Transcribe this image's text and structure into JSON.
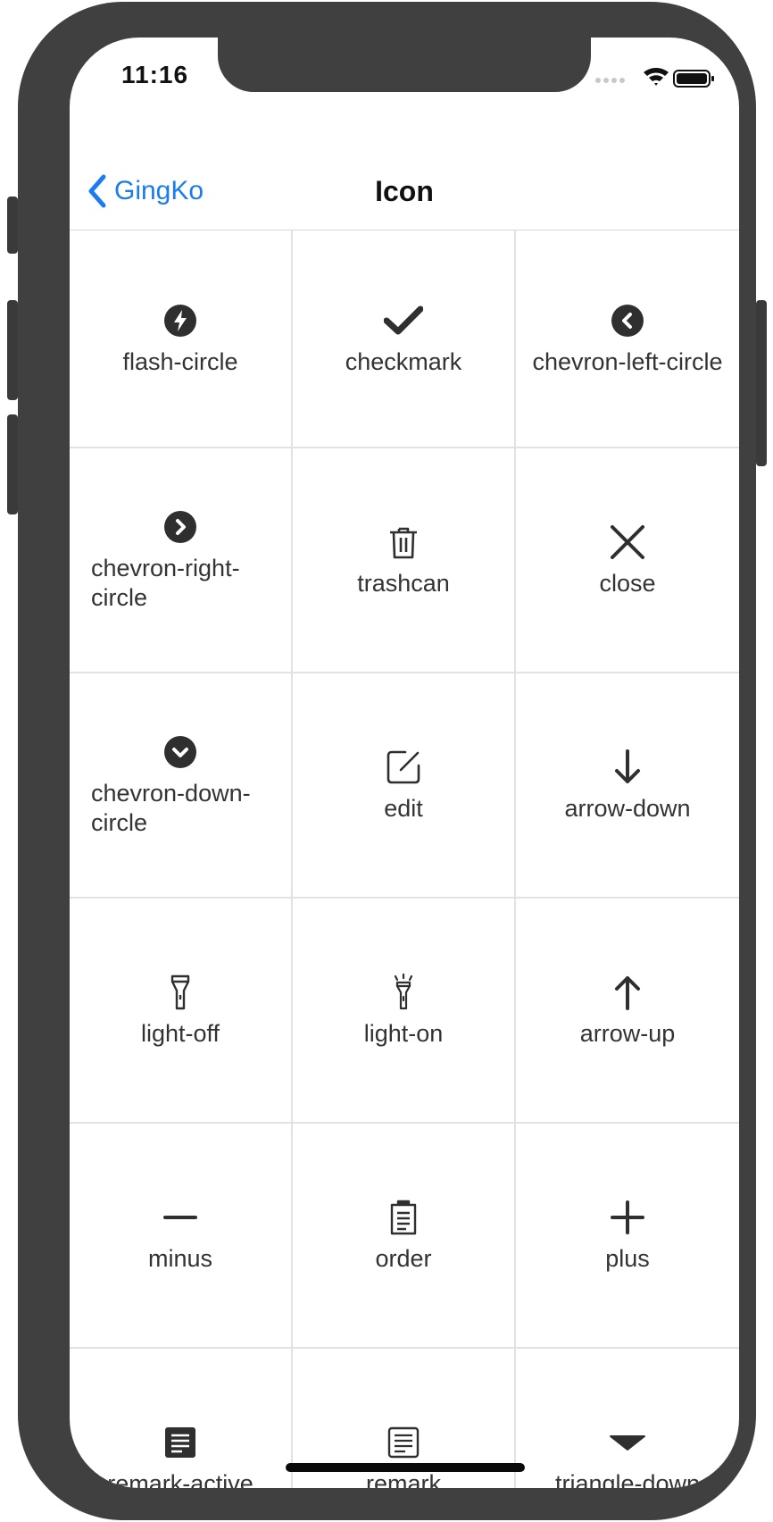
{
  "status_bar": {
    "time": "11:16"
  },
  "nav": {
    "back_label": "GingKo",
    "title": "Icon"
  },
  "icons": [
    [
      {
        "label": "flash-circle",
        "icon": "flash-circle-icon"
      },
      {
        "label": "checkmark",
        "icon": "checkmark-icon"
      },
      {
        "label": "chevron-left-circle",
        "icon": "chevron-left-circle-icon"
      }
    ],
    [
      {
        "label": "chevron-right-circle",
        "icon": "chevron-right-circle-icon"
      },
      {
        "label": "trashcan",
        "icon": "trashcan-icon"
      },
      {
        "label": "close",
        "icon": "close-icon"
      }
    ],
    [
      {
        "label": "chevron-down-circle",
        "icon": "chevron-down-circle-icon"
      },
      {
        "label": "edit",
        "icon": "edit-icon"
      },
      {
        "label": "arrow-down",
        "icon": "arrow-down-icon"
      }
    ],
    [
      {
        "label": "light-off",
        "icon": "light-off-icon"
      },
      {
        "label": "light-on",
        "icon": "light-on-icon"
      },
      {
        "label": "arrow-up",
        "icon": "arrow-up-icon"
      }
    ],
    [
      {
        "label": "minus",
        "icon": "minus-icon"
      },
      {
        "label": "order",
        "icon": "order-icon"
      },
      {
        "label": "plus",
        "icon": "plus-icon"
      }
    ],
    [
      {
        "label": "remark-active",
        "icon": "remark-active-icon"
      },
      {
        "label": "remark",
        "icon": "remark-icon"
      },
      {
        "label": "triangle-down",
        "icon": "triangle-down-icon"
      }
    ]
  ],
  "colors": {
    "accent": "#1b7cf0",
    "icon": "#2f2f2f",
    "grid_line": "#e2e2e2",
    "frame": "#404040"
  }
}
